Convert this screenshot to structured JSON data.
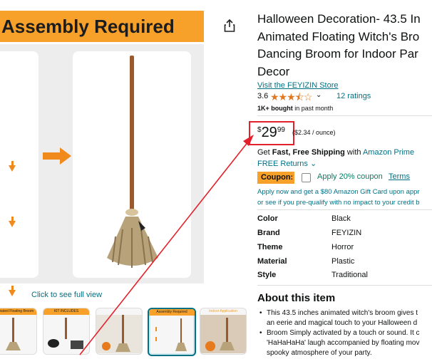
{
  "gallery": {
    "banner_text": "Assembly Required",
    "full_view_link": "Click to see full view",
    "thumbnail_labels": [
      "Animated Floating Broom",
      "KIT INCLUDES",
      "",
      "Assembly Required",
      "Indoor Application"
    ]
  },
  "product": {
    "title_lines": [
      "Halloween Decoration- 43.5 In",
      "Animated Floating Witch's Bro",
      "Dancing Broom for Indoor Par",
      "Decor"
    ],
    "store_link": "Visit the FEYIZIN Store",
    "rating_value": "3.6",
    "stars": "★★★⯪☆",
    "rating_count": "12 ratings",
    "bought_bold": "1K+ bought",
    "bought_rest": " in past month"
  },
  "price": {
    "symbol": "$",
    "whole": "29",
    "fraction": "99",
    "unit_price": "($2.34 / ounce)"
  },
  "shipping": {
    "prefix": "Get ",
    "bold": "Fast, Free Shipping",
    "mid": " with ",
    "prime_link": "Amazon Prime",
    "returns_link": "FREE Returns"
  },
  "coupon": {
    "badge": "Coupon:",
    "text": "Apply 20% coupon",
    "terms": "Terms"
  },
  "gift_card": {
    "line1": "Apply now and get a $80 Amazon Gift Card upon appr",
    "line2": "or see if you pre-qualify with no impact to your credit b"
  },
  "specs": [
    {
      "key": "Color",
      "value": "Black"
    },
    {
      "key": "Brand",
      "value": "FEYIZIN"
    },
    {
      "key": "Theme",
      "value": "Horror"
    },
    {
      "key": "Material",
      "value": "Plastic"
    },
    {
      "key": "Style",
      "value": "Traditional"
    }
  ],
  "about": {
    "heading": "About this item",
    "bullet_lines": [
      [
        "This 43.5 inches animated witch's broom gives t",
        "an eerie and magical touch to your Halloween d"
      ],
      [
        "Broom Simply activated by a touch or sound. It c",
        "'HaHaHaHa' laugh accompanied by floating mov",
        "spooky atmosphere of your party."
      ]
    ]
  },
  "colors": {
    "accent_orange": "#f7a12a",
    "link_teal": "#007185",
    "highlight_red": "#e3202b",
    "coupon_green": "#067d62"
  }
}
